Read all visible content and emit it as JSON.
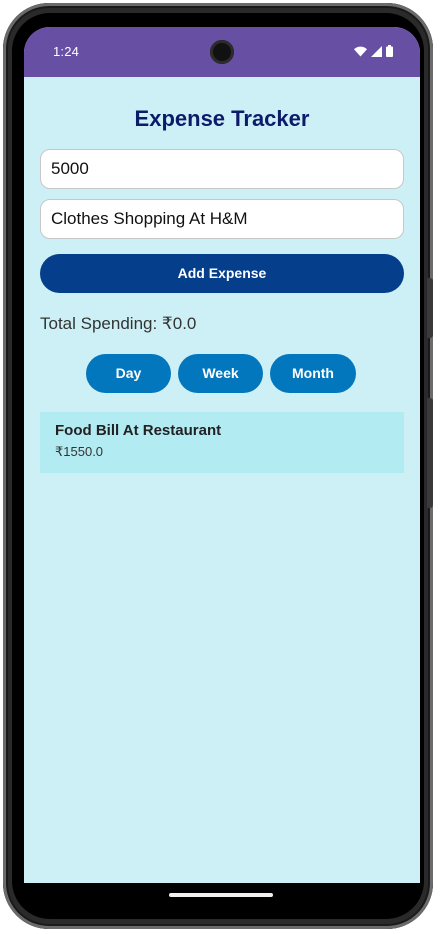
{
  "status_bar": {
    "time": "1:24",
    "icons": [
      "wifi-icon",
      "signal-icon",
      "battery-icon"
    ],
    "color": "#6750a4"
  },
  "app": {
    "title": "Expense Tracker",
    "background": "#ccf0f6"
  },
  "form": {
    "amount_value": "5000",
    "description_value": "Clothes Shopping At H&M",
    "add_button_label": "Add Expense"
  },
  "summary": {
    "total_label": "Total Spending: ₹0.0"
  },
  "filters": [
    {
      "label": "Day"
    },
    {
      "label": "Week"
    },
    {
      "label": "Month"
    }
  ],
  "expenses": [
    {
      "title": "Food Bill At Restaurant",
      "amount": "₹1550.0"
    }
  ],
  "colors": {
    "title": "#0d1b6b",
    "add_button": "#053e8a",
    "filter_button": "#0277bd",
    "expense_card": "#b2ebf2"
  }
}
